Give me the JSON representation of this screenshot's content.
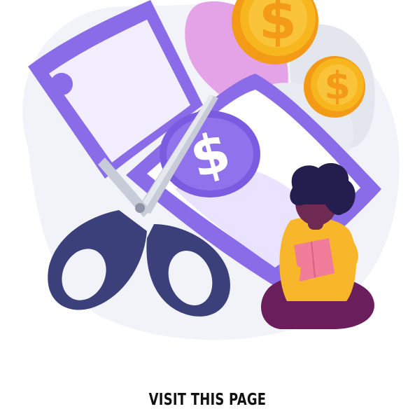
{
  "illustration": {
    "subject": "cut-money",
    "currency_symbol": "$",
    "colors": {
      "blob": "#F1F3F9",
      "bill_purple": "#8B6CE8",
      "bill_light": "#F3EEFF",
      "coin_gold": "#F7B51E",
      "coin_shade": "#F39A16",
      "scissors_handle": "#3B3F7A",
      "scissors_blade": "#C8CCD8",
      "leaf_pink": "#E3A3E6",
      "leaf_gray": "#E4E6EE",
      "person_hair": "#241E4E",
      "person_shirt": "#F8B62A",
      "person_skin": "#6E2A53",
      "person_legs": "#6A1F5C",
      "book_pink": "#F07E9A"
    }
  },
  "cta": {
    "label": "VISIT THIS PAGE"
  }
}
